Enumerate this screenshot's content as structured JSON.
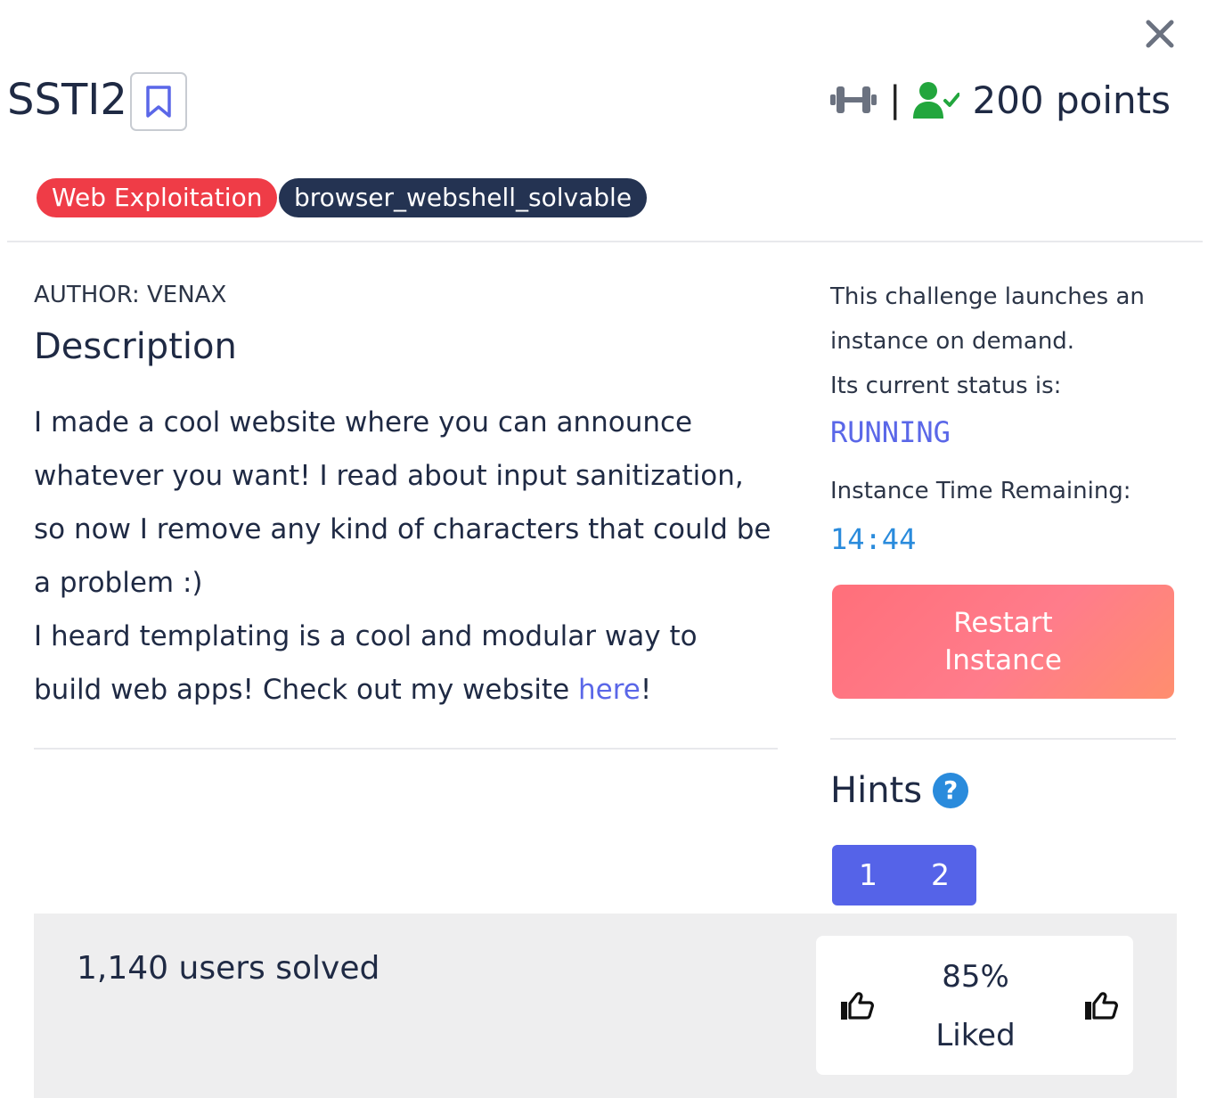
{
  "challenge": {
    "title": "SSTI2",
    "points_label": "200 points",
    "tags": [
      "Web Exploitation",
      "browser_webshell_solvable"
    ]
  },
  "description": {
    "author": "AUTHOR: VENAX",
    "heading": "Description",
    "paragraph1": "I made a cool website where you can announce whatever you want! I read about input sanitization, so now I remove any kind of characters that could be a problem :)",
    "paragraph2_prefix": "I heard templating is a cool and modular way to build web apps! Check out my website ",
    "link_text": "here",
    "paragraph2_suffix": "!"
  },
  "instance": {
    "intro": "This challenge launches an instance on demand.",
    "status_label": "Its current status is:",
    "status": "RUNNING",
    "time_label": "Instance Time Remaining:",
    "time_remaining": "14:44",
    "restart_label": "Restart Instance"
  },
  "hints": {
    "title": "Hints",
    "help_glyph": "?",
    "buttons": [
      "1",
      "2"
    ]
  },
  "footer": {
    "solved": "1,140 users solved",
    "like_percent": "85%",
    "liked_label": "Liked"
  },
  "icons": {
    "close": "close-icon",
    "bookmark": "bookmark-icon",
    "difficulty": "dumbbell-icon",
    "solved": "user-check-icon",
    "thumbs_down": "thumbs-down-icon",
    "thumbs_up": "thumbs-up-icon"
  },
  "colors": {
    "category_tag": "#ef3c47",
    "flag_tag": "#243352",
    "status": "#5a67e8",
    "timer": "#2a8bdc",
    "hint_buttons": "#5563e8",
    "solved_icon": "#22a63d"
  }
}
